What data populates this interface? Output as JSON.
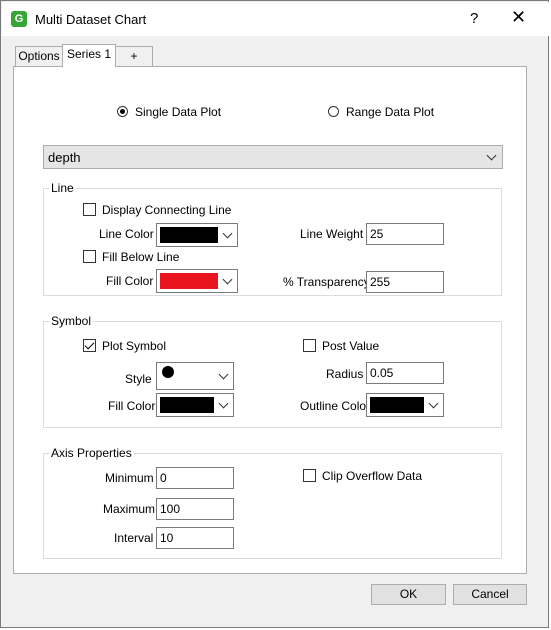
{
  "window": {
    "title": "Multi Dataset Chart",
    "help": "?",
    "close": "✕",
    "app_icon_letter": "G"
  },
  "tabs": [
    {
      "label": "Options"
    },
    {
      "label": "Series 1"
    },
    {
      "label": "+"
    }
  ],
  "plot_mode": {
    "single_label": "Single Data Plot",
    "range_label": "Range Data Plot",
    "selected": "single"
  },
  "dataset": {
    "value": "depth"
  },
  "line": {
    "title": "Line",
    "display_connecting_label": "Display Connecting Line",
    "display_connecting_checked": false,
    "line_color_label": "Line Color",
    "line_color": "#000000",
    "line_weight_label": "Line Weight",
    "line_weight": "25",
    "fill_below_label": "Fill Below Line",
    "fill_below_checked": false,
    "fill_color_label": "Fill Color",
    "fill_color": "#e8141e",
    "transparency_label": "% Transparency",
    "transparency": "255"
  },
  "symbol": {
    "title": "Symbol",
    "plot_symbol_label": "Plot Symbol",
    "plot_symbol_checked": true,
    "post_value_label": "Post Value",
    "post_value_checked": false,
    "style_label": "Style",
    "style": "filled-circle",
    "radius_label": "Radius",
    "radius": "0.05",
    "fill_color_label": "Fill Color",
    "fill_color": "#000000",
    "outline_color_label": "Outline Color",
    "outline_color": "#000000"
  },
  "axis": {
    "title": "Axis Properties",
    "minimum_label": "Minimum",
    "minimum": "0",
    "maximum_label": "Maximum",
    "maximum": "100",
    "interval_label": "Interval",
    "interval": "10",
    "clip_label": "Clip Overflow Data",
    "clip_checked": false
  },
  "buttons": {
    "ok": "OK",
    "cancel": "Cancel"
  }
}
